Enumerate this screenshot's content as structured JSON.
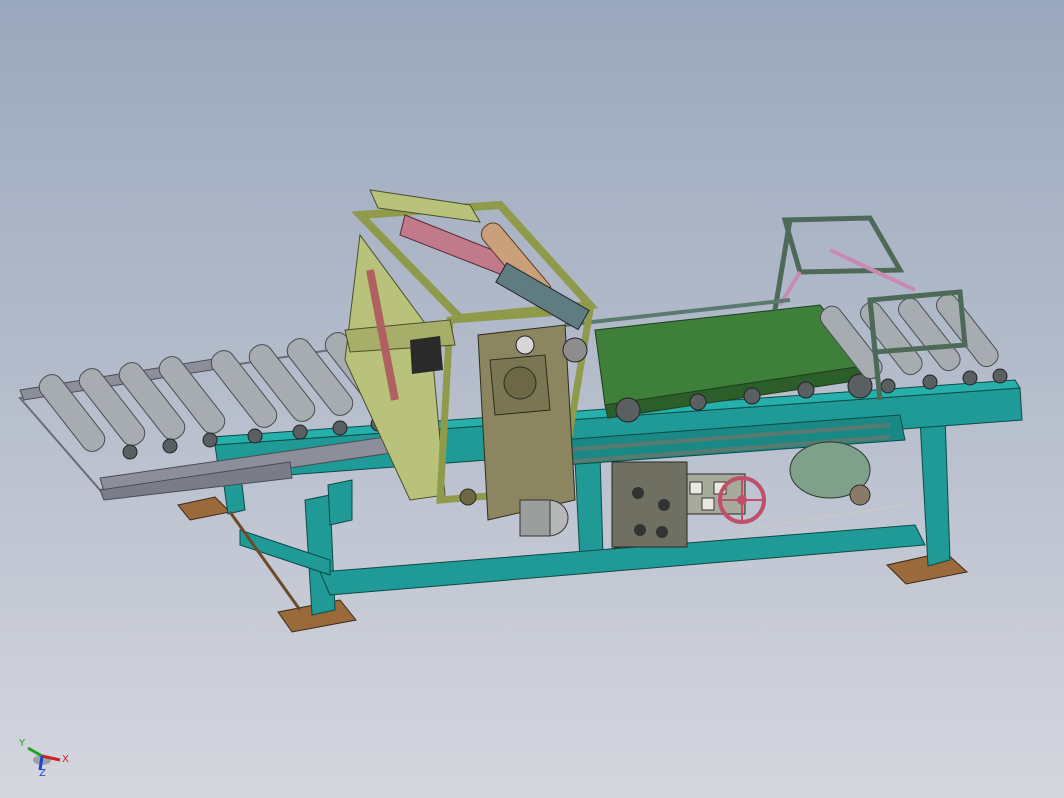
{
  "viewport": {
    "background_top": "#9aa8bd",
    "background_bottom": "#d5d6de"
  },
  "model": {
    "frame_color": "#1f9a96",
    "roller_color": "#a7acb0",
    "gantry_color": "#b9c27a",
    "belt_color": "#3e7f3a",
    "base_plate_color": "#9a6a3a",
    "infeed_rail_color": "#8c8f9a",
    "motor_color": "#b5b8b6",
    "handwheel_color": "#c0506a",
    "housing_color": "#8b8660",
    "control_box_color": "#a7ab9c"
  },
  "triad": {
    "x_label": "X",
    "y_label": "Y",
    "z_label": "Z",
    "x_color": "#d02020",
    "y_color": "#20a020",
    "z_color": "#2040d0"
  }
}
